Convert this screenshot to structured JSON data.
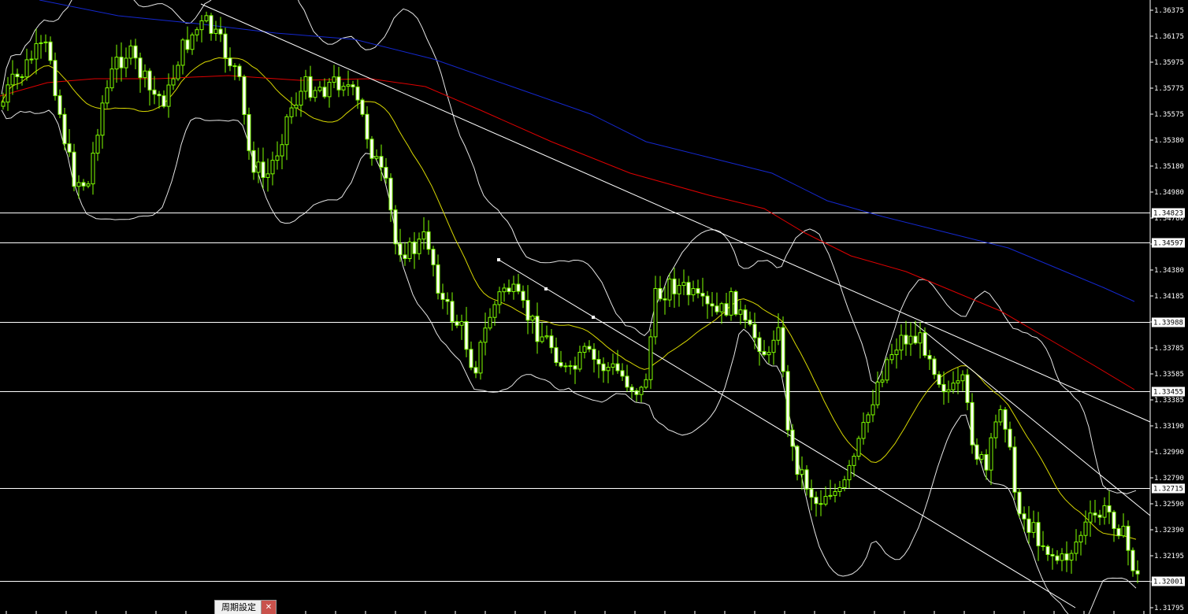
{
  "price_axis": {
    "labels": [
      "1.36375",
      "1.36175",
      "1.35975",
      "1.35775",
      "1.35575",
      "1.35380",
      "1.35180",
      "1.34980",
      "1.34780",
      "1.34580",
      "1.34380",
      "1.34185",
      "1.33985",
      "1.33785",
      "1.33585",
      "1.33385",
      "1.33190",
      "1.32990",
      "1.32790",
      "1.32590",
      "1.32390",
      "1.32195",
      "1.31995",
      "1.31795"
    ],
    "top_value": 1.36375,
    "bottom_value": 1.31795,
    "text_color": "#ffffff"
  },
  "horizontal_levels": [
    {
      "value": 1.34823,
      "label": "1.34823"
    },
    {
      "value": 1.34597,
      "label": "1.34597"
    },
    {
      "value": 1.33988,
      "label": "1.33988"
    },
    {
      "value": 1.33455,
      "label": "1.33455"
    },
    {
      "value": 1.32715,
      "label": "1.32715"
    },
    {
      "value": 1.32001,
      "label": "1.32001"
    }
  ],
  "colors": {
    "background": "#000000",
    "candle_bull_fill": "#000000",
    "candle_bear_fill": "#ffffff",
    "candle_outline": "#7fff00",
    "candle_wick": "#7fff00",
    "bollinger": "#e6e6e6",
    "ma_fast": "#d8d800",
    "ma_mid": "#e00000",
    "ma_slow": "#1428d0",
    "level_line": "#ffffff",
    "trendline": "#ffffff"
  },
  "bottom_tab": {
    "label": "周期設定",
    "close_icon": "close-icon"
  }
}
